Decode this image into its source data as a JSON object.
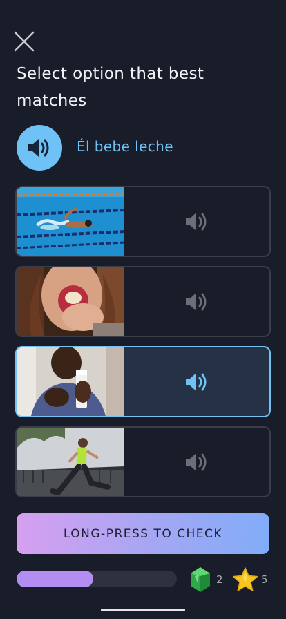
{
  "prompt": "Select option that best matches",
  "phrase": "Él bebe leche",
  "options": [
    {
      "id": "swimming",
      "selected": false
    },
    {
      "id": "eating-apple",
      "selected": false
    },
    {
      "id": "drinking-milk",
      "selected": true
    },
    {
      "id": "running",
      "selected": false
    }
  ],
  "check_button": "LONG-PRESS TO CHECK",
  "progress": 0.48,
  "gems": "2",
  "stars": "5",
  "icons": {
    "close": "close-icon",
    "speaker": "speaker-icon",
    "gem": "gem-icon",
    "star": "star-icon"
  },
  "colors": {
    "background": "#191c29",
    "accent": "#6fc2f6",
    "selected_border": "#74c1f2",
    "progress": "#b48df2"
  }
}
